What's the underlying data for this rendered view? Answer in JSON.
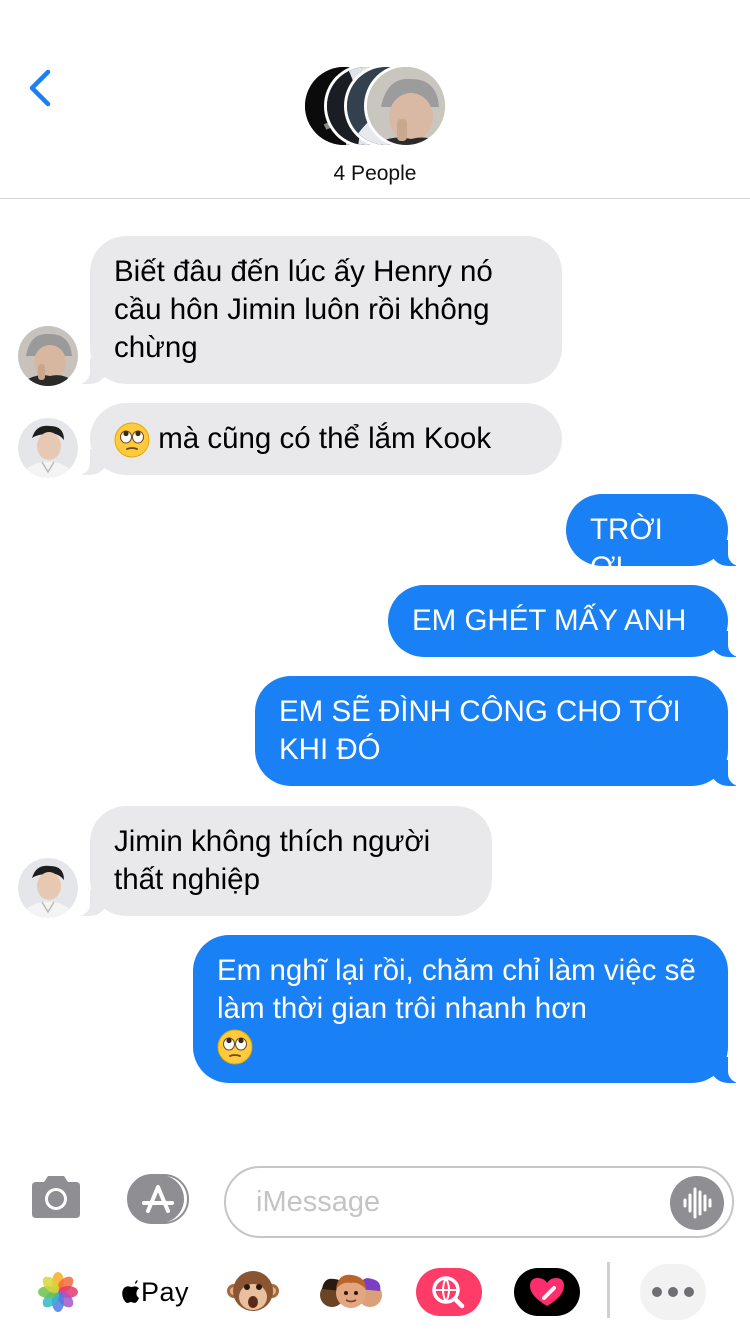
{
  "header": {
    "title": "4 People",
    "back_icon": "chevron-left-icon",
    "accent_color": "#1a80f6"
  },
  "messages": [
    {
      "direction": "incoming",
      "text": "Biết đâu đến lúc ấy Henry nó cầu hôn Jimin luôn rồi không chừng",
      "sender_avatar": "avatar-gray-beanie"
    },
    {
      "direction": "incoming",
      "emoji": "face-with-rolling-eyes-icon",
      "text": " mà cũng có thể lắm Kook",
      "sender_avatar": "avatar-white-shirt"
    },
    {
      "direction": "outgoing",
      "text": "TRỜI ƠI"
    },
    {
      "direction": "outgoing",
      "text": "EM GHÉT MẤY ANH"
    },
    {
      "direction": "outgoing",
      "text": "EM SẼ ĐÌNH CÔNG CHO TỚI KHI ĐÓ"
    },
    {
      "direction": "incoming",
      "text": "Jimin không thích người thất nghiệp",
      "sender_avatar": "avatar-white-shirt"
    },
    {
      "direction": "outgoing",
      "text": "Em nghĩ lại rồi, chăm chỉ làm việc sẽ làm thời gian trôi nhanh hơn",
      "trailing_emoji": "face-with-rolling-eyes-icon"
    }
  ],
  "composer": {
    "placeholder": "iMessage",
    "value": ""
  },
  "app_drawer": {
    "apple_pay_label": "Pay",
    "apps": [
      "photos-icon",
      "apple-pay-icon",
      "monkey-animoji-icon",
      "memoji-icon",
      "web-search-icon",
      "digital-touch-icon",
      "more-icon"
    ]
  },
  "colors": {
    "outgoing_bubble": "#1a80f6",
    "incoming_bubble": "#e9e9eb",
    "battery": "#f2c200"
  }
}
